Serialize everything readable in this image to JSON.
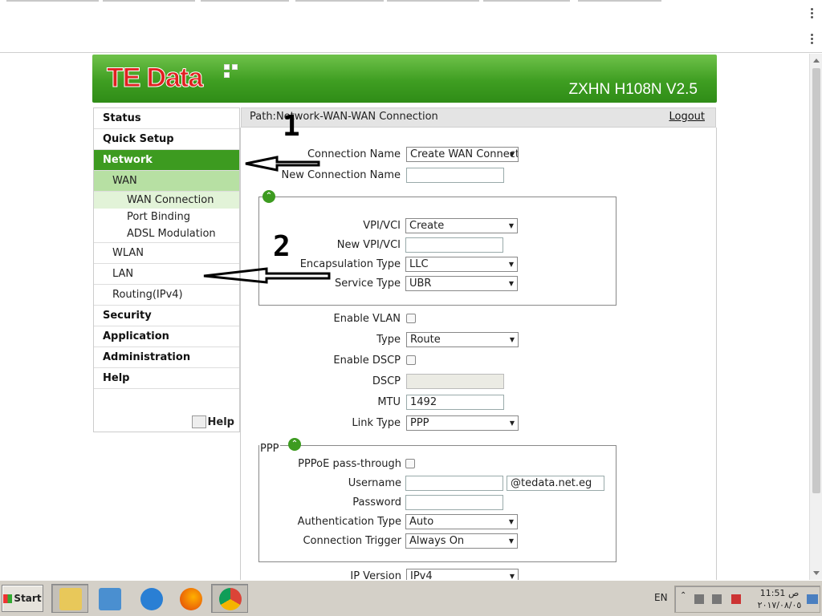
{
  "router": {
    "logo_text_te": "TE",
    "logo_text_data": "Data",
    "model": "ZXHN H108N V2.5"
  },
  "sidebar": {
    "items": [
      {
        "label": "Status"
      },
      {
        "label": "Quick Setup"
      },
      {
        "label": "Network",
        "active": true
      },
      {
        "label": "WAN"
      },
      {
        "label": "WAN Connection"
      },
      {
        "label": "Port Binding"
      },
      {
        "label": "ADSL Modulation"
      },
      {
        "label": "WLAN"
      },
      {
        "label": "LAN"
      },
      {
        "label": "Routing(IPv4)"
      },
      {
        "label": "Security"
      },
      {
        "label": "Application"
      },
      {
        "label": "Administration"
      },
      {
        "label": "Help"
      }
    ],
    "help_link": "Help"
  },
  "path_bar": {
    "path": "Path:Network-WAN-WAN Connection",
    "logout": "Logout"
  },
  "form": {
    "connection_name_label": "Connection Name",
    "connection_name_value": "Create WAN Connection",
    "new_connection_name_label": "New Connection Name",
    "new_connection_name_value": "",
    "vpi_vci_label": "VPI/VCI",
    "vpi_vci_value": "Create",
    "new_vpi_vci_label": "New VPI/VCI",
    "encapsulation_label": "Encapsulation Type",
    "encapsulation_value": "LLC",
    "service_type_label": "Service Type",
    "service_type_value": "UBR",
    "enable_vlan_label": "Enable VLAN",
    "type_label": "Type",
    "type_value": "Route",
    "enable_dscp_label": "Enable DSCP",
    "dscp_label": "DSCP",
    "mtu_label": "MTU",
    "mtu_value": "1492",
    "link_type_label": "Link Type",
    "link_type_value": "PPP",
    "ppp_legend": "PPP",
    "pppoe_label": "PPPoE pass-through",
    "username_label": "Username",
    "username_suffix": "@tedata.net.eg",
    "password_label": "Password",
    "auth_type_label": "Authentication Type",
    "auth_type_value": "Auto",
    "conn_trigger_label": "Connection Trigger",
    "conn_trigger_value": "Always On",
    "ip_version_label": "IP Version",
    "ip_version_value": "IPv4"
  },
  "annotations": {
    "num1": "1",
    "num2": "2"
  },
  "taskbar": {
    "start_label": "Start",
    "language": "EN",
    "time": "11:51 ص",
    "date": "٢٠١٧/٠٨/٠٥"
  }
}
